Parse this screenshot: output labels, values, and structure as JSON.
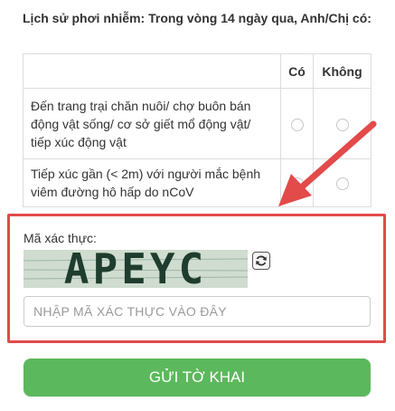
{
  "section": {
    "title": "Lịch sử phơi nhiễm: Trong vòng 14 ngày qua, Anh/Chị có:"
  },
  "table": {
    "columns": [
      "",
      "Có",
      "Không"
    ],
    "rows": [
      {
        "question": "Đến trang trại chăn nuôi/ chợ buôn bán động vật sống/ cơ sở giết mổ động vật/ tiếp xúc động vật"
      },
      {
        "question": "Tiếp xúc gần (< 2m) với người mắc bệnh viêm đường hô hấp do nCoV"
      }
    ]
  },
  "captcha": {
    "label": "Mã xác thực:",
    "image_text": "APEYC",
    "refresh_icon": "refresh-icon",
    "input_value": "",
    "input_placeholder": "NHẬP MÃ XÁC THỰC VÀO ĐÂY"
  },
  "submit": {
    "label": "GỬI TỜ KHAI"
  },
  "colors": {
    "accent_green": "#5cb85c",
    "highlight_red": "#e34a4a"
  }
}
